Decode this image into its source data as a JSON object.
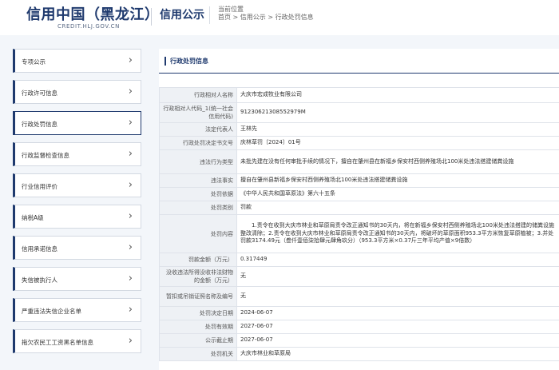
{
  "header": {
    "logo_title": "信用中国（黑龙江）",
    "logo_sub": "CREDIT.HLJ.GOV.CN",
    "section_title": "信用公示",
    "location_label": "当前位置",
    "breadcrumb": [
      "首页",
      "信用公示",
      "行政处罚信息"
    ],
    "breadcrumb_sep": " > "
  },
  "sidebar": {
    "items": [
      {
        "label": "专项公示"
      },
      {
        "label": "行政许可信息"
      },
      {
        "label": "行政处罚信息"
      },
      {
        "label": "行政监督检查信息"
      },
      {
        "label": "行业信用评价"
      },
      {
        "label": "纳税A级"
      },
      {
        "label": "信用承诺信息"
      },
      {
        "label": "失信被执行人"
      },
      {
        "label": "严重违法失信企业名单"
      },
      {
        "label": "拖欠农民工工资黑名单信息"
      }
    ]
  },
  "content": {
    "title": "行政处罚信息",
    "rows": [
      {
        "key": "行政相对人名称",
        "value": "大庆市宏成牧业有限公司"
      },
      {
        "key": "行政相对人代码_1(统一社会信用代码)",
        "value": "91230621308552979M"
      },
      {
        "key": "法定代表人",
        "value": "王林先"
      },
      {
        "key": "行政处罚决定书文号",
        "value": "庆林草罚〔2024〕01号"
      },
      {
        "key": "违法行为类型",
        "value": "未批先建在没有任何审批手续的情况下，擅自在肇州县在新福乡保安村西侧养殖场北100米处违法搭建储粪设施"
      },
      {
        "key": "违法事实",
        "value": "擅自在肇州县新福乡保安村西侧养殖场北100米处违法搭建储粪设施"
      },
      {
        "key": "处罚依据",
        "value": "《中华人民共和国草原法》第六十五条"
      },
      {
        "key": "处罚类别",
        "value": "罚款"
      },
      {
        "key": "处罚内容",
        "value": "1.责令在收到大庆市林业和草原局责令改正通知书的30天内，将在新福乡保安村西侧养殖场北100米处违法搭建的储粪设施整改清除；2.责令在收到大庆市林业和草原局责令改正通知书的30天内，将破坏的草原面积953.3平方米恢复草原植被；3.并处罚款3174.49元（叁仟壹佰柒拾肆元肆角玖分）（953.3平方米×0.37斤三年平均产值×9倍数）",
        "indent": true
      },
      {
        "key": "罚款金额（万元）",
        "value": "0.317449"
      },
      {
        "key": "没收违法所得没收非法财物的金额（万元）",
        "value": "无"
      },
      {
        "key": "暂扣或吊销证照名称及编号",
        "value": "无"
      },
      {
        "key": "处罚决定日期",
        "value": "2024-06-07"
      },
      {
        "key": "处罚有效期",
        "value": "2027-06-07"
      },
      {
        "key": "公示截止期",
        "value": "2027-06-07"
      },
      {
        "key": "处罚机关",
        "value": "大庆市林业和草原局"
      }
    ]
  },
  "colors": {
    "accent": "#1f3a6e",
    "page_bg": "#f3f6fa",
    "label_bg": "#eef1f5"
  }
}
